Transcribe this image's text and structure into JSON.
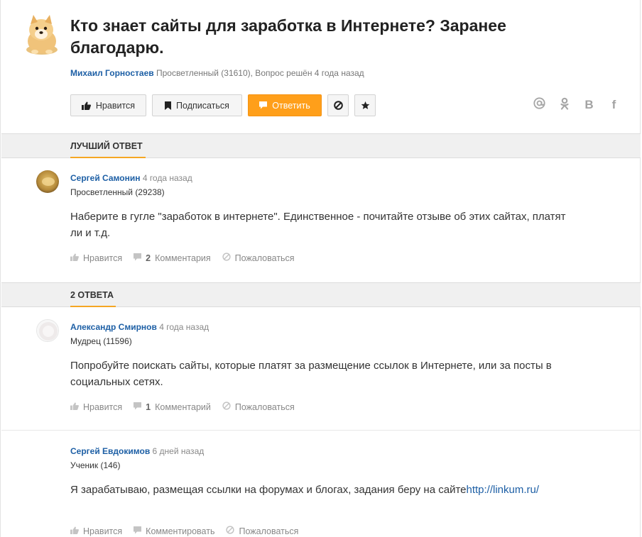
{
  "question": {
    "title": "Кто знает сайты для заработка в Интернете? Заранее благодарю.",
    "author": "Михаил Горностаев",
    "meta": "Просветленный (31610), Вопрос решён 4 года назад"
  },
  "actions": {
    "like": "Нравится",
    "subscribe": "Подписаться",
    "answer": "Ответить"
  },
  "share": {
    "ok": "ok-icon",
    "vk": "В",
    "fb": "f"
  },
  "sections": {
    "best": "ЛУЧШИЙ ОТВЕТ",
    "answers": "2 ОТВЕТА"
  },
  "best_answer": {
    "name": "Сергей Самонин",
    "time": "4 года назад",
    "rank": "Просветленный (29238)",
    "text": "Наберите в гугле \"заработок в интернете\". Единственное - почитайте отзыве об этих сайтах, платят ли и т.д.",
    "like": "Нравится",
    "comments_count": "2",
    "comments_label": "Комментария",
    "report": "Пожаловаться"
  },
  "answers": [
    {
      "name": "Александр Смирнов",
      "time": "4 года назад",
      "rank": "Мудрец (11596)",
      "text": "Попробуйте поискать сайты, которые платят за размещение ссылок в Интернете, или за посты в социальных сетях.",
      "like": "Нравится",
      "comments_count": "1",
      "comments_label": "Комментарий",
      "report": "Пожаловаться"
    },
    {
      "name": "Сергей Евдокимов",
      "time": "6 дней назад",
      "rank": "Ученик (146)",
      "text_before": "Я зарабатываю, размещая ссылки на форумах и блогах, задания беру на сайте",
      "link": "http://linkum.ru/",
      "like": "Нравится",
      "comment": "Комментировать",
      "report": "Пожаловаться"
    }
  ]
}
